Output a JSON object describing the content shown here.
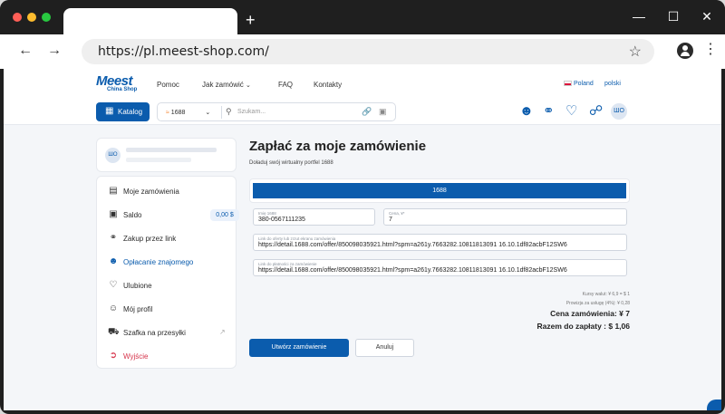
{
  "browser": {
    "url": "https://pl.meest-shop.com/",
    "new_tab": "+",
    "win_min": "—",
    "win_max": "☐",
    "win_close": "✕",
    "back": "←",
    "forward": "→",
    "bookmark_icon": "☆",
    "menu_icon": "⋮"
  },
  "header": {
    "logo": "Meest",
    "logo_sub": "China Shop",
    "nav": [
      "Pomoc",
      "Jak zamówić",
      "FAQ",
      "Kontakty"
    ],
    "country": "Poland",
    "language": "polski"
  },
  "toolbar": {
    "katalog": "Katalog",
    "source": "1688",
    "search_placeholder": "Szukam...",
    "avatar": "ШО"
  },
  "sidebar": {
    "profile_initials": "ШО",
    "items": [
      {
        "label": "Moje zamówienia",
        "icon": "orders-icon"
      },
      {
        "label": "Saldo",
        "icon": "wallet-icon",
        "badge": "0,00 $"
      },
      {
        "label": "Zakup przez link",
        "icon": "link-icon"
      },
      {
        "label": "Opłacanie znajomego",
        "icon": "users-icon"
      },
      {
        "label": "Ulubione",
        "icon": "heart-icon"
      },
      {
        "label": "Mój profil",
        "icon": "profile-icon"
      },
      {
        "label": "Szafka na przesyłki",
        "icon": "truck-icon"
      },
      {
        "label": "Wyjście",
        "icon": "logout-icon"
      }
    ]
  },
  "main": {
    "title": "Zapłać za moje zamówienie",
    "subtitle": "Doładuj swój wirtualny portfel 1688",
    "selected_platform": "1688",
    "fields": {
      "login_label": "Imię 1688",
      "login_value": "380-0567111235",
      "price_label": "Cena, ¥*",
      "price_value": "7",
      "link_label": "Link do oferty lub zrzut ekranu zamówienia",
      "link_value": "https://detail.1688.com/offer/850098035921.html?spm=a261y.7663282.10811813091 16.10.1df82acbF12SW6",
      "pay_link_label": "Link do płatności za zamówienie",
      "pay_link_value": "https://detail.1688.com/offer/850098035921.html?spm=a261y.7663282.10811813091 16.10.1df82acbF12SW6"
    },
    "summary": {
      "rate": "Kursy walut: ¥ 6,9 = $ 1",
      "commission": "Prowizja za usługę (4%): ¥ 0,28",
      "order_price": "Cena zamówienia: ¥ 7",
      "total": "Razem do zapłaty : $ 1,06"
    },
    "create_button": "Utwórz zamówienie",
    "cancel_button": "Anuluj"
  },
  "colors": {
    "accent": "#0b5cad",
    "logout": "#d6334a"
  }
}
